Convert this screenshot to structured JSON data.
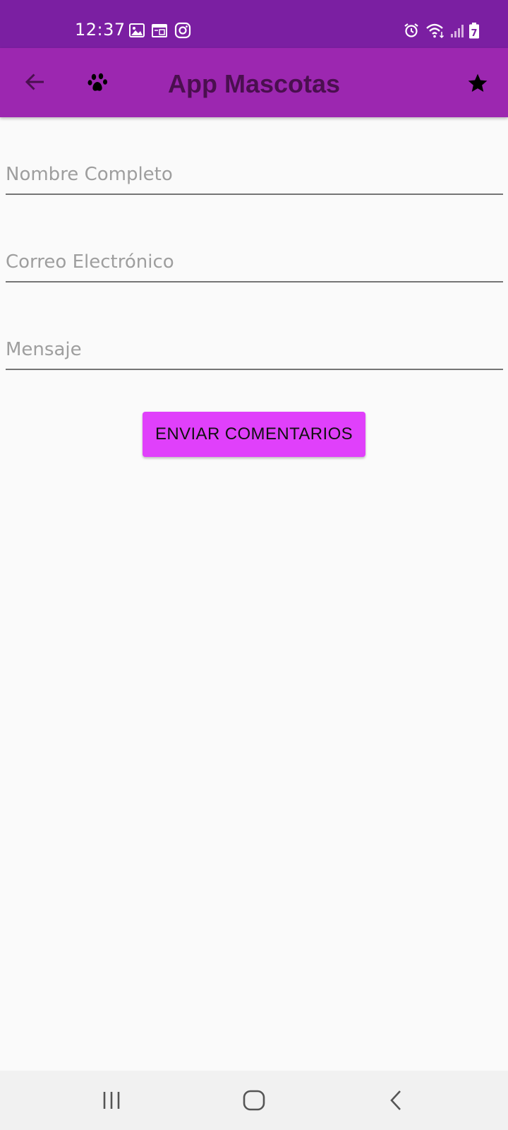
{
  "status_bar": {
    "time": "12:37",
    "left_icons": [
      "image-icon",
      "calendar-icon",
      "instagram-icon"
    ],
    "right_icons": [
      "alarm-icon",
      "wifi-icon",
      "signal-icon",
      "battery-icon"
    ],
    "battery_level": "7"
  },
  "app_bar": {
    "title": "App Mascotas",
    "background": "#9c27b0",
    "title_color": "#4a0f4f",
    "icons": [
      "back-arrow-icon",
      "paw-icon",
      "star-icon"
    ]
  },
  "form": {
    "name_placeholder": "Nombre Completo",
    "email_placeholder": "Correo Electrónico",
    "message_placeholder": "Mensaje",
    "submit_label": "ENVIAR COMENTARIOS",
    "submit_color": "#e040fb"
  },
  "nav_bar": {
    "icons": [
      "recent-apps-icon",
      "home-icon",
      "back-icon"
    ]
  }
}
